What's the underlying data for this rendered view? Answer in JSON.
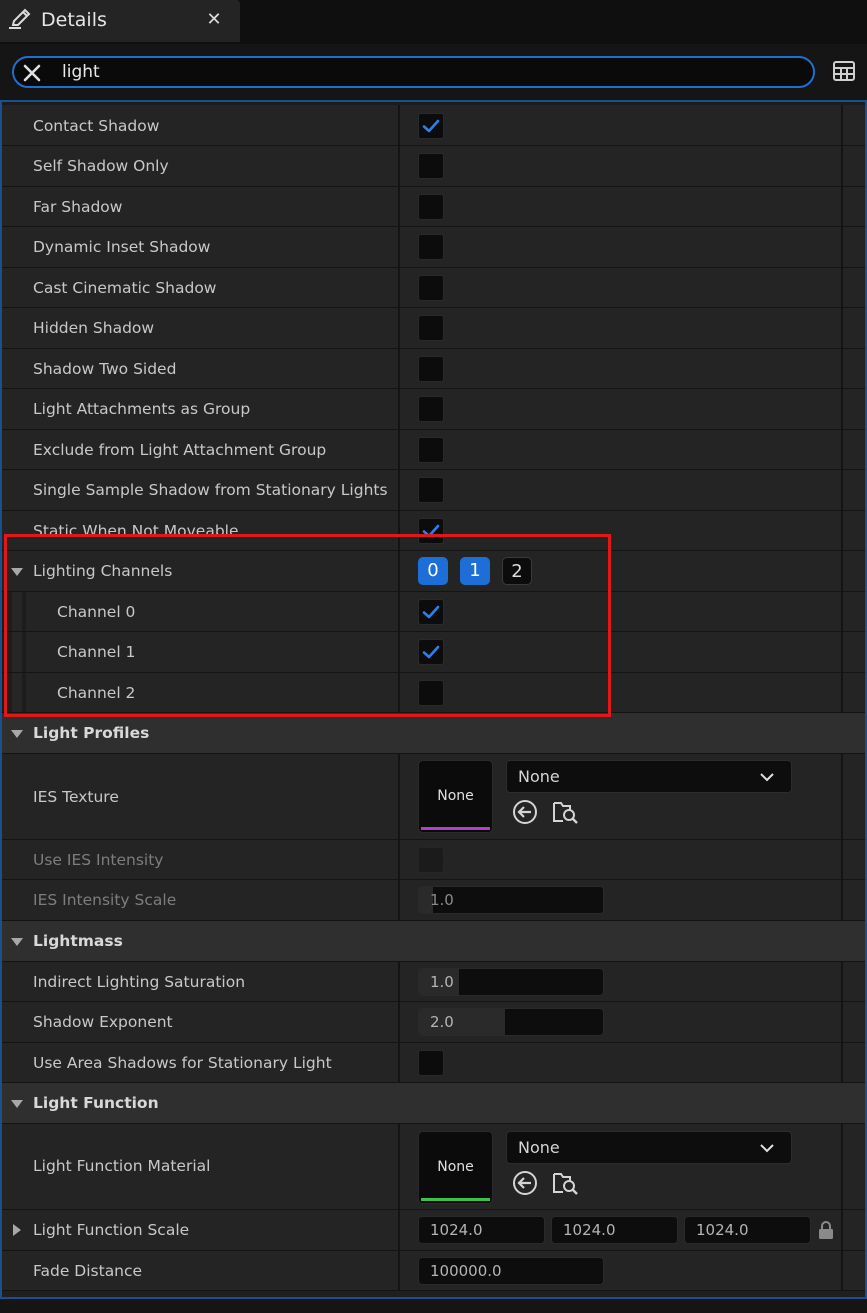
{
  "tab": {
    "title": "Details",
    "icon": "pencil-icon",
    "close_glyph": "✕"
  },
  "search": {
    "value": "light",
    "clear_icon": "close-icon"
  },
  "toolbar": {
    "view_options_icon": "table-grid-icon"
  },
  "rows": {
    "contact_shadow": {
      "label": "Contact Shadow",
      "checked": true
    },
    "self_shadow_only": {
      "label": "Self Shadow Only",
      "checked": false
    },
    "far_shadow": {
      "label": "Far Shadow",
      "checked": false
    },
    "dynamic_inset_shadow": {
      "label": "Dynamic Inset Shadow",
      "checked": false
    },
    "cast_cinematic_shadow": {
      "label": "Cast Cinematic Shadow",
      "checked": false
    },
    "hidden_shadow": {
      "label": "Hidden Shadow",
      "checked": false
    },
    "shadow_two_sided": {
      "label": "Shadow Two Sided",
      "checked": false
    },
    "light_attachments_as_group": {
      "label": "Light Attachments as Group",
      "checked": false
    },
    "exclude_from_light_attachment_group": {
      "label": "Exclude from Light Attachment Group",
      "checked": false
    },
    "single_sample_shadow": {
      "label": "Single Sample Shadow from Stationary Lights",
      "checked": false
    },
    "static_when_not_moveable": {
      "label": "Static When Not Moveable",
      "checked": true
    }
  },
  "lighting_channels": {
    "label": "Lighting Channels",
    "chips": [
      {
        "label": "0",
        "on": true
      },
      {
        "label": "1",
        "on": true
      },
      {
        "label": "2",
        "on": false
      }
    ],
    "channels": [
      {
        "label": "Channel 0",
        "checked": true
      },
      {
        "label": "Channel 1",
        "checked": true
      },
      {
        "label": "Channel 2",
        "checked": false
      }
    ]
  },
  "light_profiles": {
    "header": "Light Profiles",
    "ies_texture": {
      "label": "IES Texture",
      "thumb_text": "None",
      "combo_value": "None",
      "accent": "#b040c8"
    },
    "use_ies_intensity": {
      "label": "Use IES Intensity",
      "checked": false
    },
    "ies_intensity_scale": {
      "label": "IES Intensity Scale",
      "value": "1.0"
    }
  },
  "lightmass": {
    "header": "Lightmass",
    "indirect_lighting_saturation": {
      "label": "Indirect Lighting Saturation",
      "value": "1.0",
      "fill": 0.22
    },
    "shadow_exponent": {
      "label": "Shadow Exponent",
      "value": "2.0",
      "fill": 0.47
    },
    "use_area_shadows": {
      "label": "Use Area Shadows for Stationary Light",
      "checked": false
    }
  },
  "light_function": {
    "header": "Light Function",
    "material": {
      "label": "Light Function Material",
      "thumb_text": "None",
      "combo_value": "None",
      "accent": "#3cc04a"
    },
    "scale": {
      "label": "Light Function Scale",
      "x": "1024.0",
      "y": "1024.0",
      "z": "1024.0"
    },
    "fade_distance": {
      "label": "Fade Distance",
      "value": "100000.0"
    }
  },
  "colors": {
    "accent": "#1e6ed8",
    "highlight": "#e01818",
    "focus_border": "#1f6fd0"
  }
}
